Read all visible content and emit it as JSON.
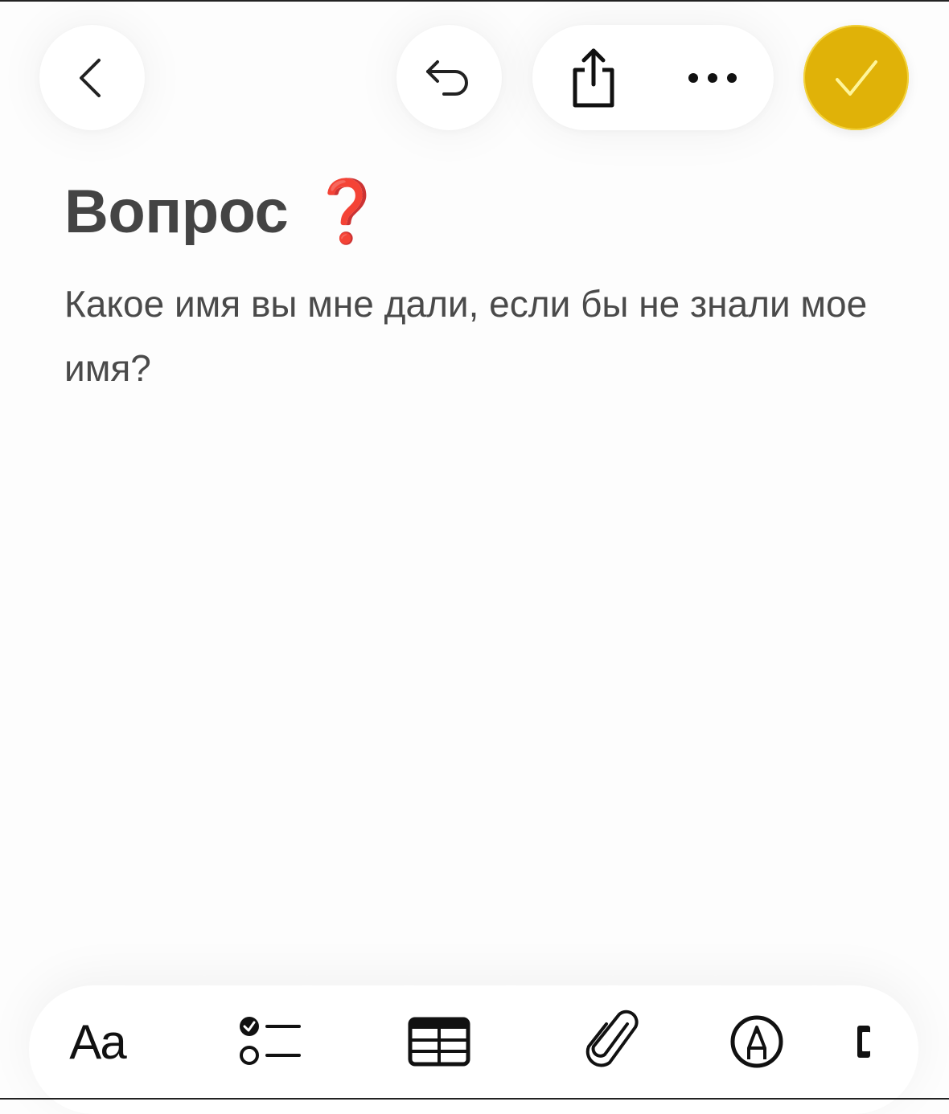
{
  "header": {
    "back_icon": "chevron-left-icon",
    "undo_icon": "undo-arrow-icon",
    "share_icon": "share-icon",
    "more_icon": "ellipsis-icon",
    "done_icon": "checkmark-icon",
    "done_color": "#e0b208"
  },
  "note": {
    "title": "Вопрос",
    "title_emoji": "❓",
    "body": "Какое имя вы мне дали, если бы не знали мое имя?"
  },
  "toolbar": {
    "format_label": "Aa",
    "checklist_icon": "checklist-icon",
    "table_icon": "table-icon",
    "attach_icon": "paperclip-icon",
    "markup_icon": "markup-pen-icon",
    "more_icon": "partial-tool-icon"
  },
  "colors": {
    "accent": "#e0b208",
    "text": "#4a4a4a",
    "emoji_red": "#d40f0f"
  }
}
